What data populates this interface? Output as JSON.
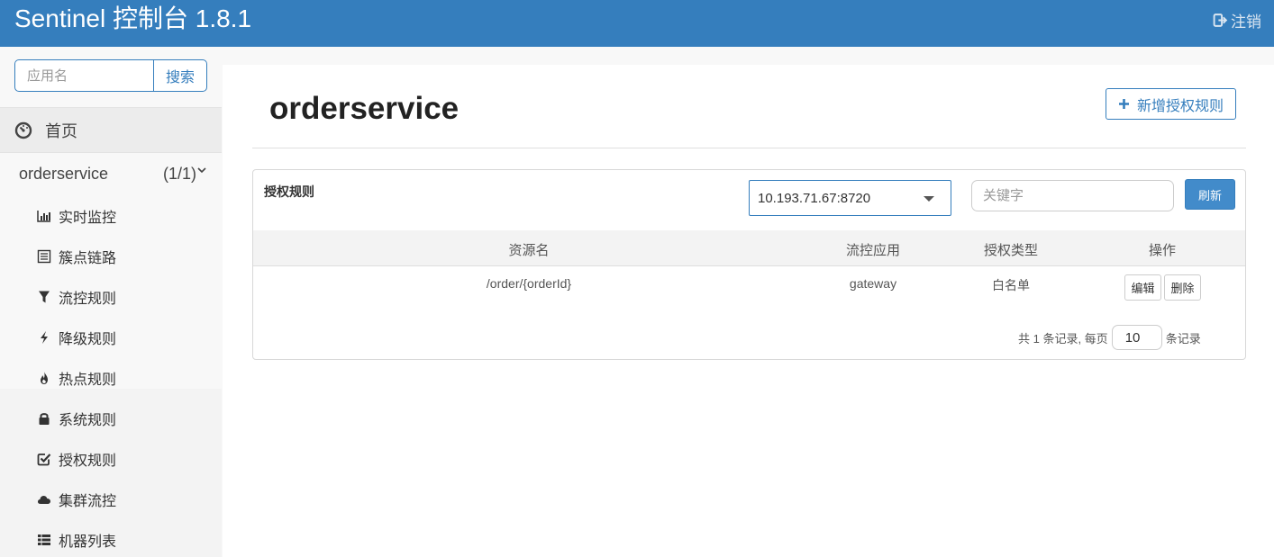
{
  "header": {
    "title": "Sentinel 控制台 1.8.1",
    "logout_label": "注销"
  },
  "sidebar": {
    "search": {
      "placeholder": "应用名",
      "button_label": "搜索"
    },
    "home_label": "首页",
    "app": {
      "name": "orderservice",
      "count": "(1/1)"
    },
    "items": [
      {
        "label": "实时监控",
        "icon": "bar-chart-icon"
      },
      {
        "label": "簇点链路",
        "icon": "list-icon"
      },
      {
        "label": "流控规则",
        "icon": "filter-icon"
      },
      {
        "label": "降级规则",
        "icon": "flash-icon"
      },
      {
        "label": "热点规则",
        "icon": "fire-icon"
      },
      {
        "label": "系统规则",
        "icon": "lock-icon"
      },
      {
        "label": "授权规则",
        "icon": "check-icon"
      },
      {
        "label": "集群流控",
        "icon": "cloud-icon"
      },
      {
        "label": "机器列表",
        "icon": "th-list-icon"
      }
    ]
  },
  "main": {
    "page_title": "orderservice",
    "add_button_label": "新增授权规则",
    "panel": {
      "title": "授权规则",
      "machine_select": "10.193.71.67:8720",
      "keyword_placeholder": "关键字",
      "refresh_label": "刷新",
      "columns": [
        "资源名",
        "流控应用",
        "授权类型",
        "操作"
      ],
      "rows": [
        {
          "resource": "/order/{orderId}",
          "app": "gateway",
          "type": "白名单",
          "edit_label": "编辑",
          "delete_label": "删除"
        }
      ],
      "pager": {
        "prefix": "共 1 条记录, 每页",
        "page_size": "10",
        "suffix": "条记录"
      }
    }
  },
  "colors": {
    "primary": "#357ebd",
    "button_primary": "#428bca"
  }
}
